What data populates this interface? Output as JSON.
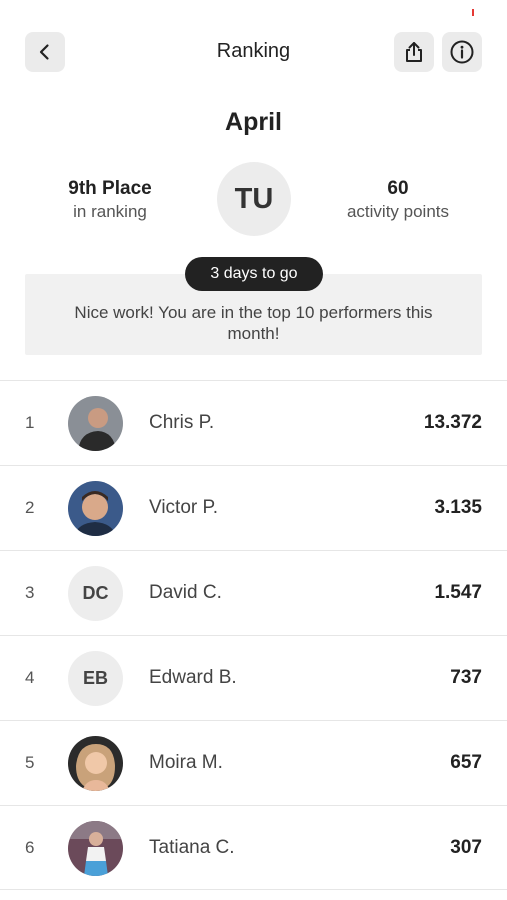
{
  "header": {
    "title": "Ranking",
    "back_icon": "chevron-left-icon",
    "share_icon": "share-icon",
    "info_icon": "info-icon"
  },
  "summary": {
    "month": "April",
    "place_value": "9th Place",
    "place_label": "in ranking",
    "user_initials": "TU",
    "points_value": "60",
    "points_label": "activity points"
  },
  "message": {
    "countdown": "3 days to go",
    "text": "Nice work! You are in the top 10 performers this month!"
  },
  "ranking": [
    {
      "rank": "1",
      "name": "Chris P.",
      "points": "13.372",
      "avatar": "photo",
      "photo_bg": "#8a8f96",
      "photo_accent": "#2a2a2a"
    },
    {
      "rank": "2",
      "name": "Victor P.",
      "points": "3.135",
      "avatar": "photo",
      "photo_bg": "#3b5a8a",
      "photo_accent": "#d9a98a"
    },
    {
      "rank": "3",
      "name": "David C.",
      "points": "1.547",
      "avatar": "initials",
      "initials": "DC"
    },
    {
      "rank": "4",
      "name": "Edward B.",
      "points": "737",
      "avatar": "initials",
      "initials": "EB"
    },
    {
      "rank": "5",
      "name": "Moira M.",
      "points": "657",
      "avatar": "photo",
      "photo_bg": "#c9a27a",
      "photo_accent": "#f0c8a8"
    },
    {
      "rank": "6",
      "name": "Tatiana C.",
      "points": "307",
      "avatar": "photo",
      "photo_bg": "#6b4a5a",
      "photo_accent": "#d8b09a"
    }
  ],
  "colors": {
    "accent_dark": "#222222",
    "panel_bg": "#f1f1f1",
    "status_mark": "#e53935"
  }
}
